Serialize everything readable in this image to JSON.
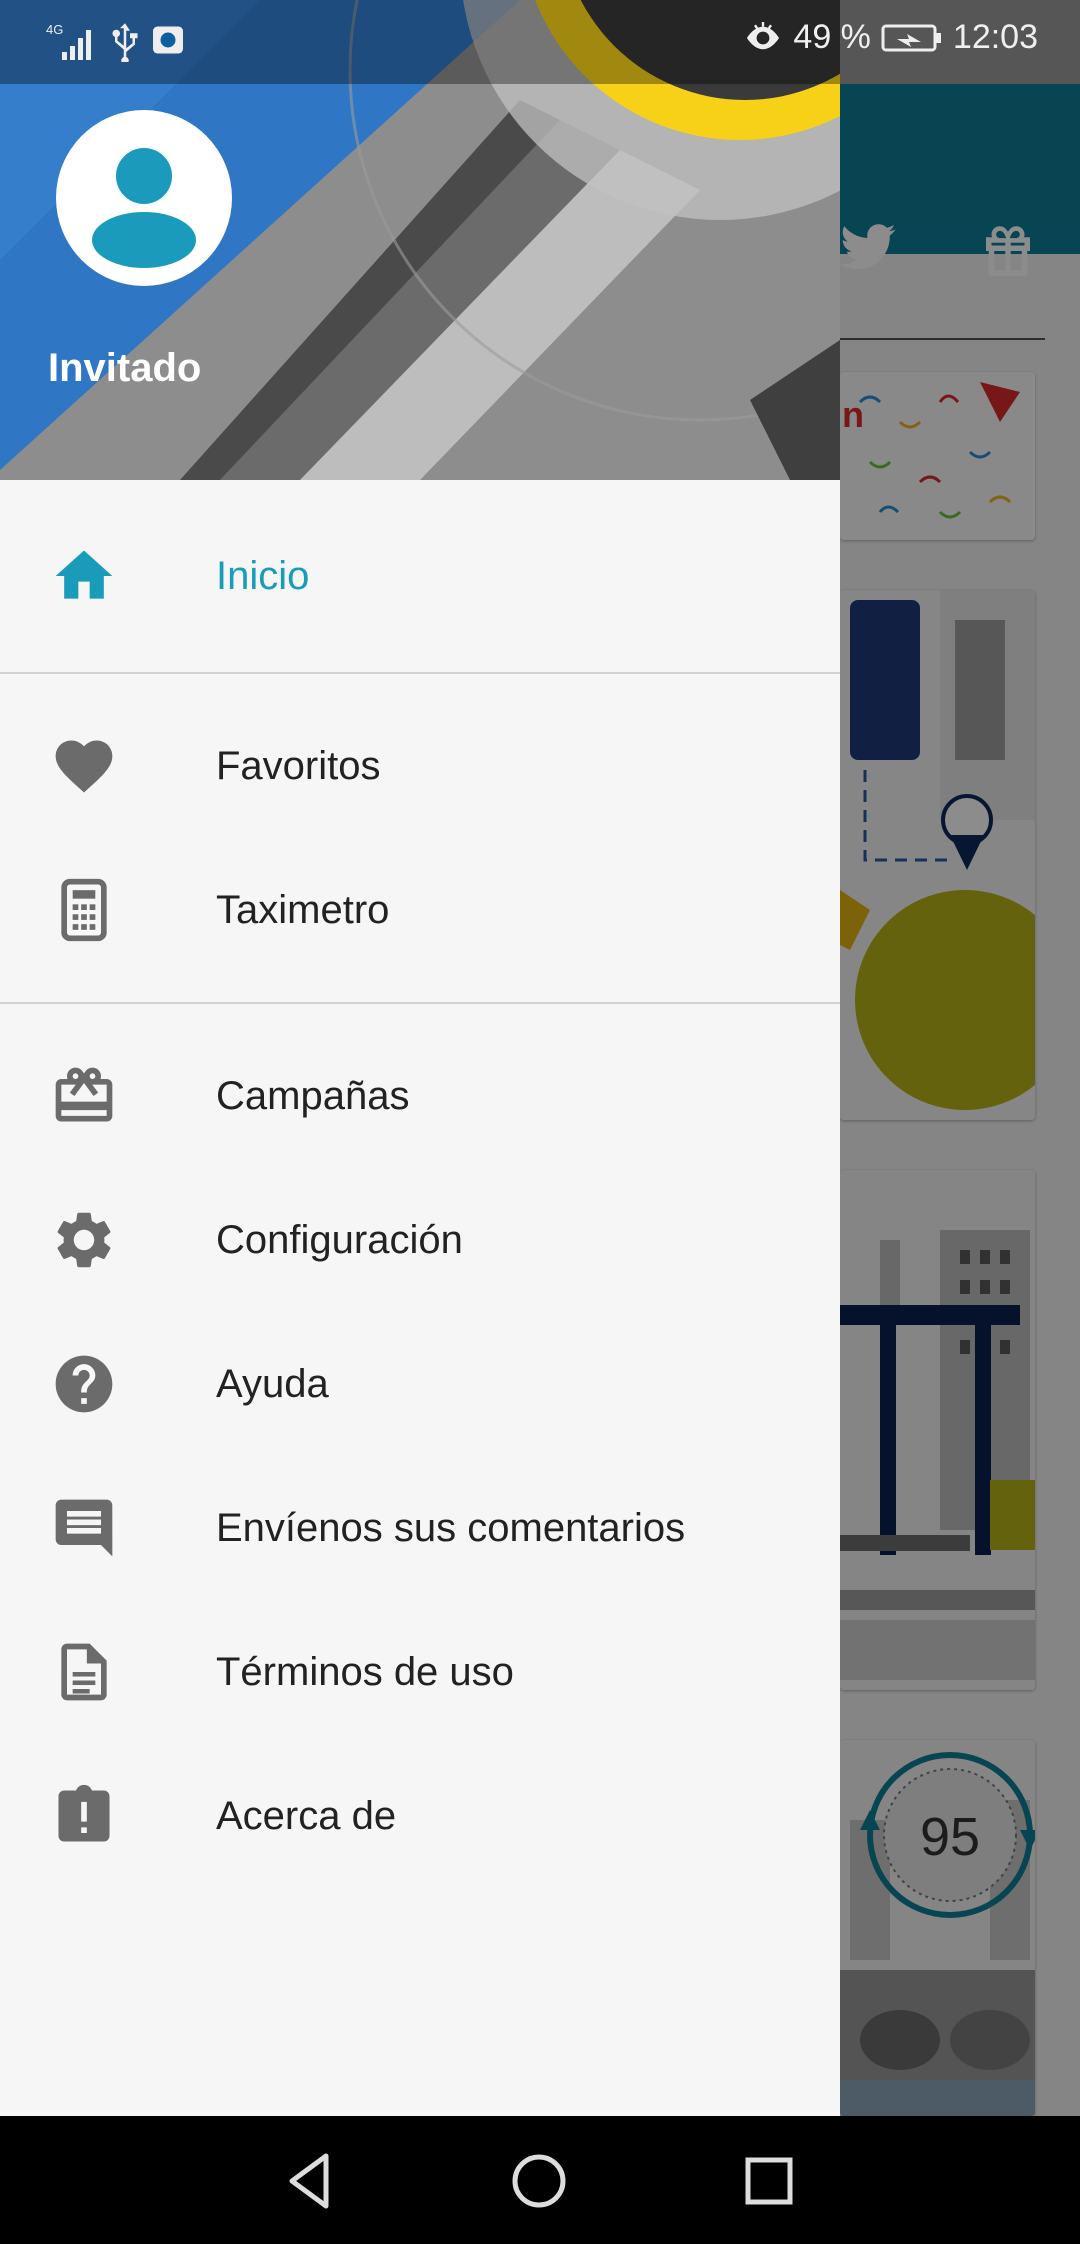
{
  "status_bar": {
    "network": "4G",
    "battery_percent": "49 %",
    "time": "12:03"
  },
  "drawer": {
    "user_name": "Invitado",
    "active_item": "Inicio",
    "groups": [
      [
        {
          "label": "Inicio",
          "icon": "home-icon"
        }
      ],
      [
        {
          "label": "Favoritos",
          "icon": "heart-icon"
        },
        {
          "label": "Taximetro",
          "icon": "calculator-icon"
        }
      ],
      [
        {
          "label": "Campañas",
          "icon": "gift-card-icon"
        },
        {
          "label": "Configuración",
          "icon": "gear-icon"
        },
        {
          "label": "Ayuda",
          "icon": "help-icon"
        },
        {
          "label": "Envíenos sus comentarios",
          "icon": "feedback-icon"
        },
        {
          "label": "Términos de uso",
          "icon": "document-icon"
        },
        {
          "label": "Acerca de",
          "icon": "info-clipboard-icon"
        }
      ]
    ]
  },
  "background": {
    "speed_value": "95"
  },
  "colors": {
    "accent": "#1a9bb9",
    "toolbar": "#0e7f96",
    "icon_gray": "#6b6b6b",
    "header_blue": "#1f6fc2",
    "header_yellow": "#f7d117"
  }
}
